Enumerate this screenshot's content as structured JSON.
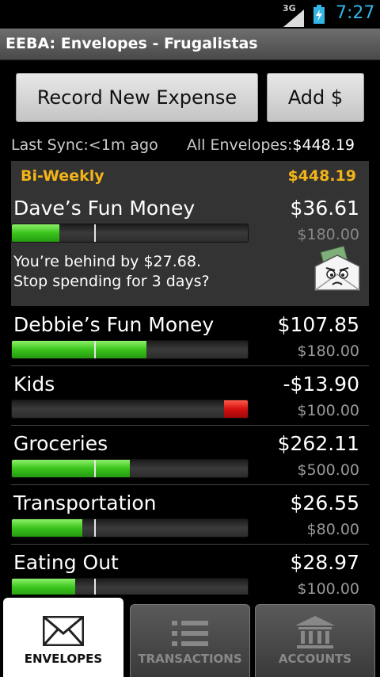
{
  "status_bar": {
    "network": "3G",
    "time": "7:27"
  },
  "title": "EEBA: Envelopes - Frugalistas",
  "buttons": {
    "record": "Record New Expense",
    "add": "Add $"
  },
  "sync": {
    "last_sync": "Last Sync:<1m ago",
    "all_label": "All Envelopes:",
    "all_amount": "$448.19"
  },
  "period": {
    "name": "Bi-Weekly",
    "amount": "$448.19"
  },
  "envelopes": [
    {
      "name": "Dave’s Fun Money",
      "balance": "$36.61",
      "budget": "$180.00",
      "fill_fraction": 0.2,
      "status": "green",
      "message_line1": "You’re behind by $27.68.",
      "message_line2": "Stop spending for 3 days?"
    },
    {
      "name": "Debbie’s Fun Money",
      "balance": "$107.85",
      "budget": "$180.00",
      "fill_fraction": 0.57,
      "status": "green"
    },
    {
      "name": "Kids",
      "balance": "-$13.90",
      "budget": "$100.00",
      "fill_fraction": 1.0,
      "status": "red"
    },
    {
      "name": "Groceries",
      "balance": "$262.11",
      "budget": "$500.00",
      "fill_fraction": 0.5,
      "status": "green"
    },
    {
      "name": "Transportation",
      "balance": "$26.55",
      "budget": "$80.00",
      "fill_fraction": 0.3,
      "status": "green"
    },
    {
      "name": "Eating Out",
      "balance": "$28.97",
      "budget": "$100.00",
      "fill_fraction": 0.27,
      "status": "green"
    }
  ],
  "tabs": [
    {
      "label": "ENVELOPES",
      "icon": "envelope-icon",
      "active": true
    },
    {
      "label": "TRANSACTIONS",
      "icon": "list-icon",
      "active": false
    },
    {
      "label": "ACCOUNTS",
      "icon": "bank-icon",
      "active": false
    }
  ],
  "colors": {
    "accent_time": "#33b5e5",
    "period_text": "#f2b418",
    "bar_green": "#3ac41c",
    "bar_red": "#d41010"
  }
}
